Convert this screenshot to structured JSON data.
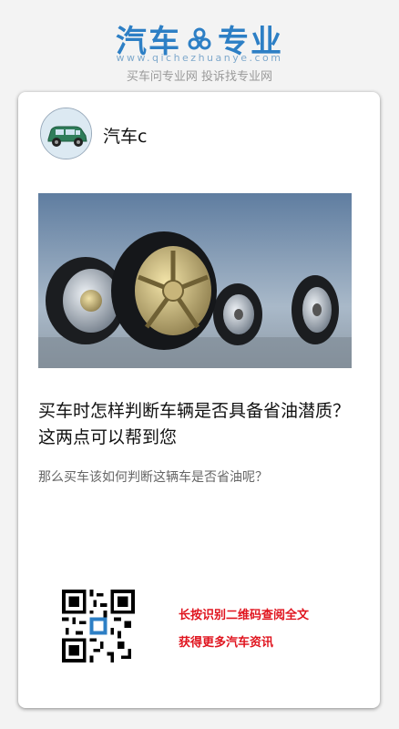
{
  "site": {
    "logo_left": "汽车",
    "logo_right": "专业",
    "url": "www.qichezhuanye.com",
    "slogan": "买车问专业网 投诉找专业网",
    "brand_color": "#2d7fc5"
  },
  "article": {
    "author": "汽车c",
    "title": "买车时怎样判断车辆是否具备省油潜质？这两点可以帮到您",
    "description": "那么买车该如何判断这辆车是否省油呢？"
  },
  "footer": {
    "cta_line1": "长按识别二维码查阅全文",
    "cta_line2": "获得更多汽车资讯",
    "cta_color": "#e0141e"
  }
}
